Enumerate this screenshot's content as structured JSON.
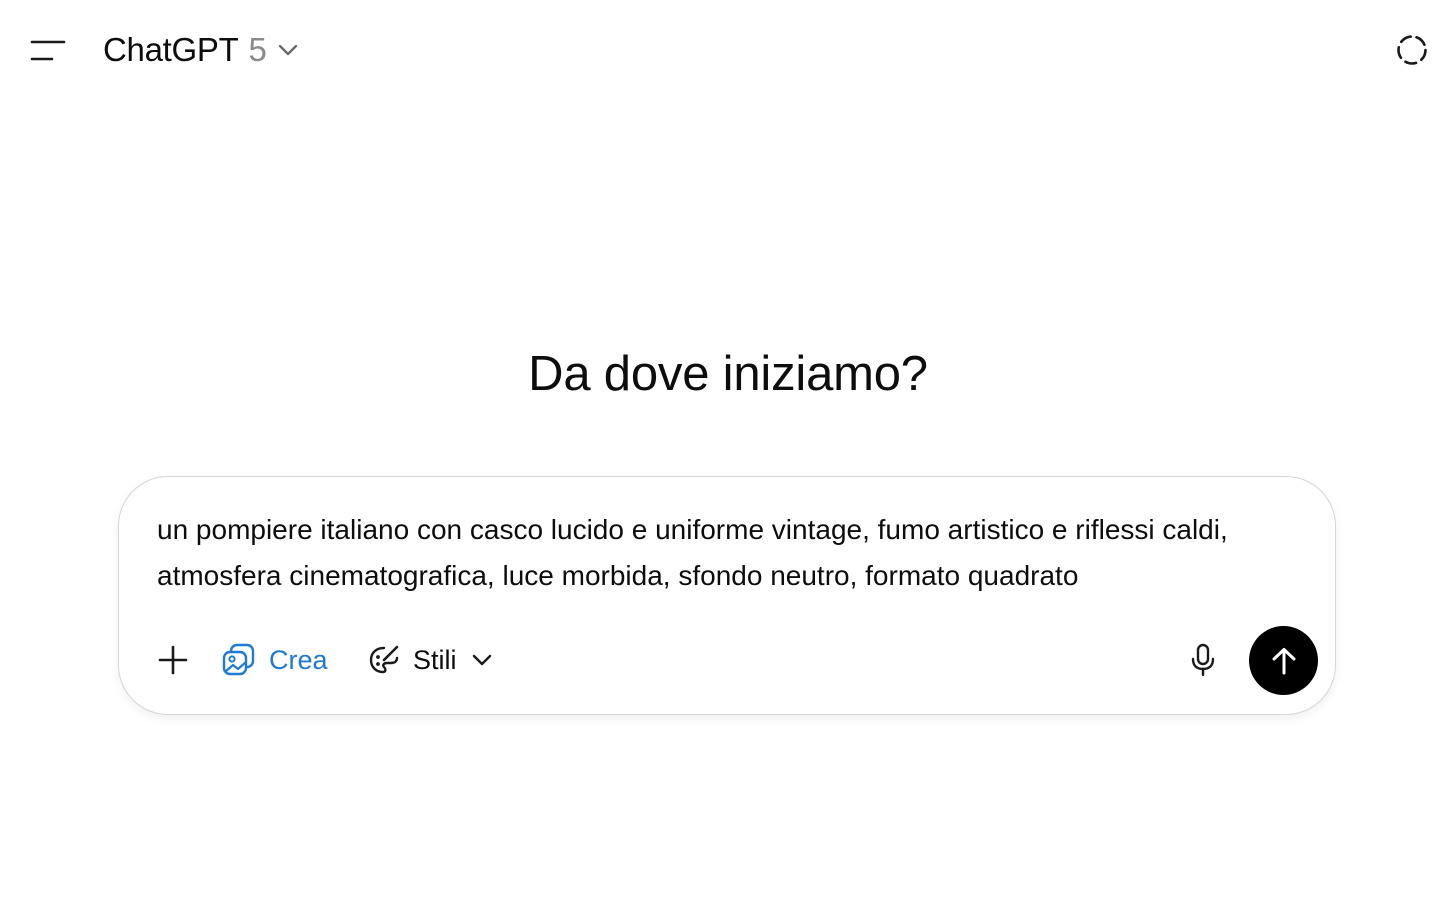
{
  "header": {
    "model_name": "ChatGPT",
    "model_version": "5",
    "menu_icon": "sidebar-toggle-icon",
    "temporary_chat_icon": "dashed-circle-icon"
  },
  "main": {
    "headline": "Da dove iniziamo?"
  },
  "composer": {
    "input_value": "un pompiere italiano con casco lucido e uniforme vintage, fumo artistico e riflessi caldi, atmosfera cinematografica, luce morbida, sfondo neutro, formato quadrato",
    "add_icon": "plus-icon",
    "crea_label": "Crea",
    "crea_icon": "images-icon",
    "stili_label": "Stili",
    "stili_icon": "palette-brush-icon",
    "mic_icon": "microphone-icon",
    "send_icon": "arrow-up-icon"
  },
  "colors": {
    "accent_blue": "#1f7ad6",
    "send_button_bg": "#000000",
    "muted_text": "#8a8a8a"
  }
}
